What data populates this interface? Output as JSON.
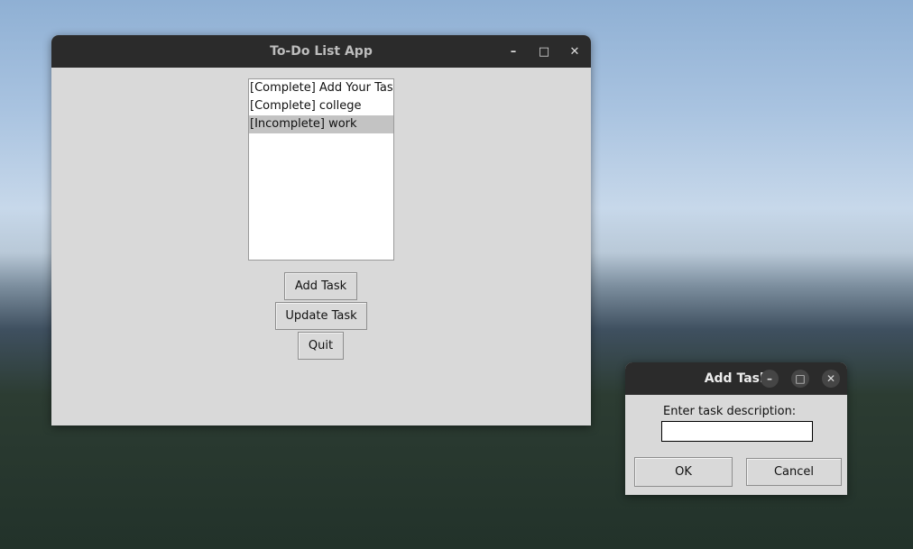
{
  "main_window": {
    "title": "To-Do List App",
    "controls": {
      "minimize": "–",
      "maximize": "□",
      "close": "✕"
    },
    "tasks": [
      {
        "label": "[Complete] Add Your Task",
        "selected": false
      },
      {
        "label": "[Complete] college",
        "selected": false
      },
      {
        "label": "[Incomplete] work",
        "selected": true
      }
    ],
    "buttons": {
      "add": "Add Task",
      "update": "Update Task",
      "quit": "Quit"
    }
  },
  "dialog": {
    "title": "Add Task",
    "controls": {
      "minimize": "–",
      "maximize": "□",
      "close": "✕"
    },
    "prompt": "Enter task description:",
    "input_value": "",
    "ok_label": "OK",
    "cancel_label": "Cancel"
  }
}
